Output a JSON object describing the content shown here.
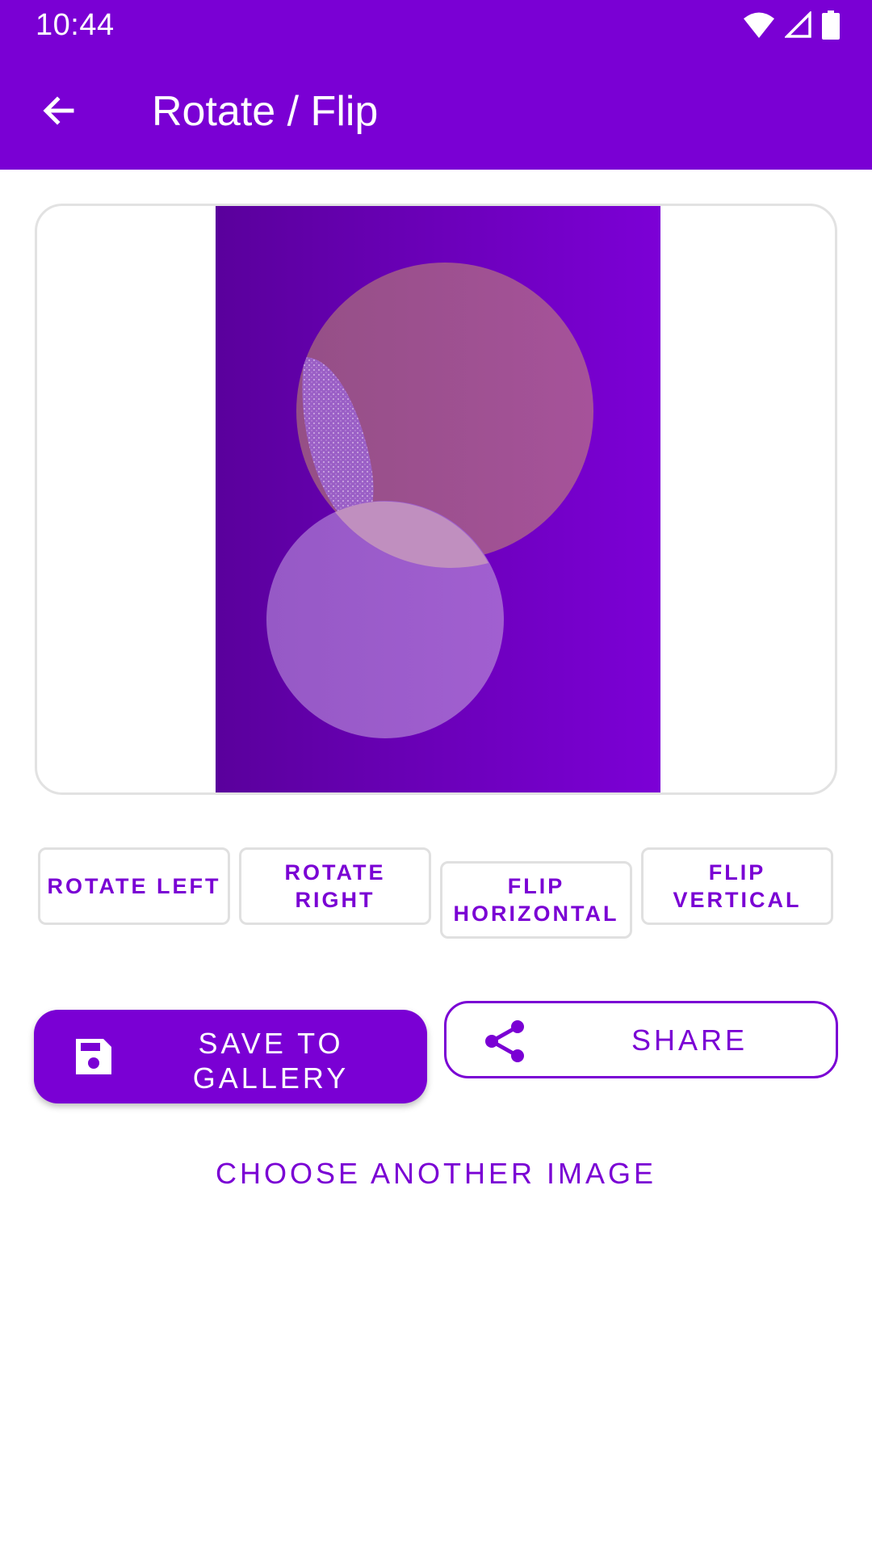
{
  "status_bar": {
    "time": "10:44",
    "icons": [
      "wifi-icon",
      "cellular-signal-icon",
      "battery-icon"
    ]
  },
  "toolbar": {
    "back_icon": "arrow-back-icon",
    "title": "Rotate / Flip"
  },
  "transform_buttons": {
    "rotate_left": "ROTATE LEFT",
    "rotate_right": "ROTATE RIGHT",
    "flip_horizontal_line1": "FLIP",
    "flip_horizontal_line2": "HORIZONTAL",
    "flip_vertical": "FLIP VERTICAL"
  },
  "actions": {
    "save_line1": "SAVE TO",
    "save_line2": "GALLERY",
    "save_icon": "floppy-disk-icon",
    "share_label": "SHARE",
    "share_icon": "share-icon",
    "choose_another": "CHOOSE ANOTHER IMAGE"
  },
  "colors": {
    "primary": "#7a00d4",
    "primary_dark": "#5a009c",
    "border": "#e2e2e2",
    "circle_top": "#a3508f",
    "circle_bottom": "#9c5bcc"
  }
}
